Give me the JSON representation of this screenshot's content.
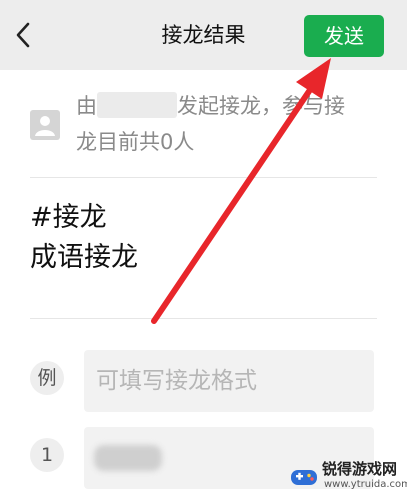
{
  "header": {
    "title": "接龙结果",
    "send_label": "发送"
  },
  "info": {
    "prefix": "由",
    "middle": "发起接龙，参与接",
    "suffix": "龙目前共0人"
  },
  "content": {
    "line1": "#接龙",
    "line2": "成语接龙"
  },
  "entries": [
    {
      "label": "例",
      "placeholder": "可填写接龙格式"
    },
    {
      "label": "1",
      "value": ""
    }
  ],
  "watermark": {
    "name": "锐得游戏网",
    "url": "www.ytruida.com"
  },
  "colors": {
    "accent": "#1aad4f",
    "annotation_arrow": "#e8262b"
  },
  "icons": {
    "back": "chevron-left-icon",
    "avatar": "default-avatar-icon",
    "watermark_logo": "gamepad-logo-icon"
  }
}
